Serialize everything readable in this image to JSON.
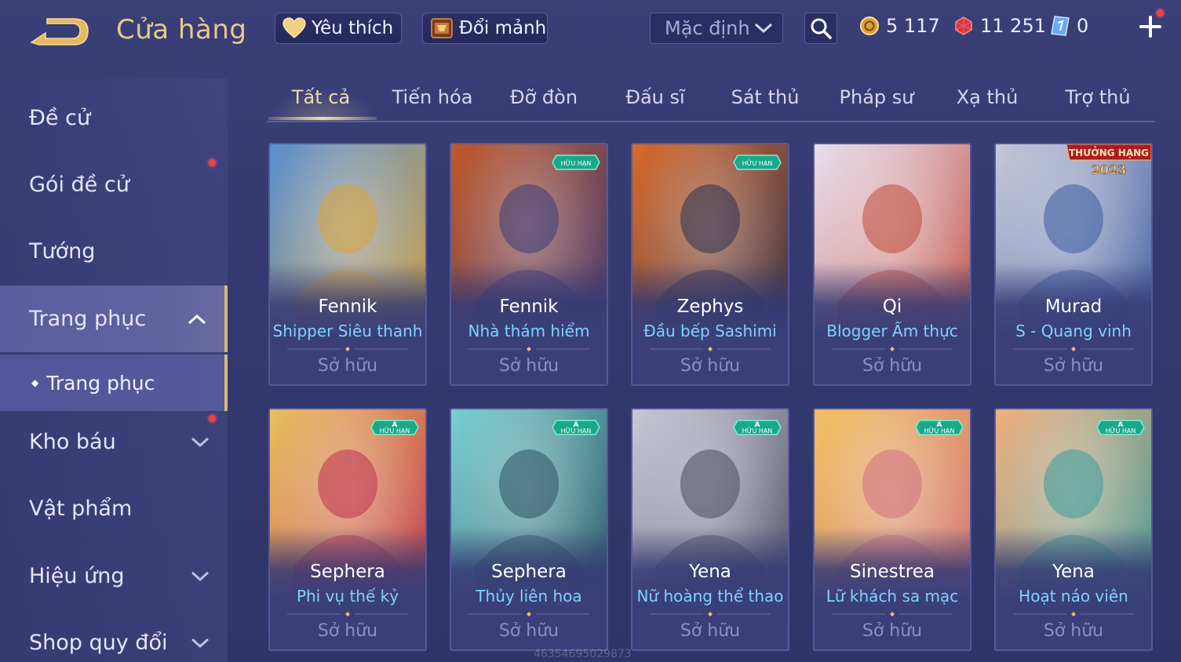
{
  "header": {
    "title": "Cửa hàng",
    "favorites_label": "Yêu thích",
    "shards_label": "Đổi mảnh",
    "sort_value": "Mặc định"
  },
  "currencies": {
    "gold": "5 117",
    "gems": "11 251",
    "vouchers": "0"
  },
  "sidebar": {
    "items": [
      {
        "label": "Đề cử"
      },
      {
        "label": "Gói đề cử"
      },
      {
        "label": "Tướng"
      },
      {
        "label": "Trang phục"
      },
      {
        "label": "Kho báu"
      },
      {
        "label": "Vật phẩm"
      },
      {
        "label": "Hiệu ứng"
      },
      {
        "label": "Shop quy đổi"
      }
    ],
    "sub_item": "Trang phục"
  },
  "tabs": [
    "Tất cả",
    "Tiến hóa",
    "Đỡ đòn",
    "Đấu sĩ",
    "Sát thủ",
    "Pháp sư",
    "Xạ thủ",
    "Trợ thủ"
  ],
  "cards": [
    {
      "hero": "Fennik",
      "skin": "Shipper Siêu thanh",
      "status": "Sở hữu",
      "palette": [
        "#5a8fd0",
        "#d9a23a"
      ]
    },
    {
      "hero": "Fennik",
      "skin": "Nhà thám hiểm",
      "status": "Sở hữu",
      "palette": [
        "#c0582a",
        "#3a3a7a"
      ],
      "badge": "HỮU HẠN"
    },
    {
      "hero": "Zephys",
      "skin": "Đầu bếp Sashimi",
      "status": "Sở hữu",
      "palette": [
        "#d96a2a",
        "#2a3050"
      ],
      "badge": "HỮU HẠN"
    },
    {
      "hero": "Qi",
      "skin": "Blogger Ẩm thực",
      "status": "Sở hữu",
      "palette": [
        "#e8e0f0",
        "#c04a3a"
      ]
    },
    {
      "hero": "Murad",
      "skin": "S - Quang vinh",
      "status": "Sở hữu",
      "palette": [
        "#c8c8d8",
        "#3a5aa0"
      ],
      "rank_badge": "THƯỞNG HẠNG",
      "rank_year": "2023"
    },
    {
      "hero": "Sephera",
      "skin": "Phi vụ thế kỷ",
      "status": "Sở hữu",
      "palette": [
        "#e8c060",
        "#c03050"
      ],
      "badge": "HỮU HẠN",
      "tier": "A"
    },
    {
      "hero": "Sephera",
      "skin": "Thủy liên hoa",
      "status": "Sở hữu",
      "palette": [
        "#7ad0d0",
        "#2a5060"
      ],
      "badge": "HỮU HẠN",
      "tier": "A"
    },
    {
      "hero": "Yena",
      "skin": "Nữ hoàng thể thao",
      "status": "Sở hữu",
      "palette": [
        "#c8c8d8",
        "#4a4a60"
      ],
      "badge": "HỮU HẠN",
      "tier": "A"
    },
    {
      "hero": "Sinestrea",
      "skin": "Lữ khách sa mạc",
      "status": "Sở hữu",
      "palette": [
        "#f0c060",
        "#d07080"
      ],
      "badge": "HỮU HẠN",
      "tier": "A"
    },
    {
      "hero": "Yena",
      "skin": "Hoạt náo viên",
      "status": "Sở hữu",
      "palette": [
        "#f0b080",
        "#3a9a9a"
      ],
      "badge": "HỮU HẠN",
      "tier": "A"
    }
  ],
  "watermark": "46354695029873"
}
